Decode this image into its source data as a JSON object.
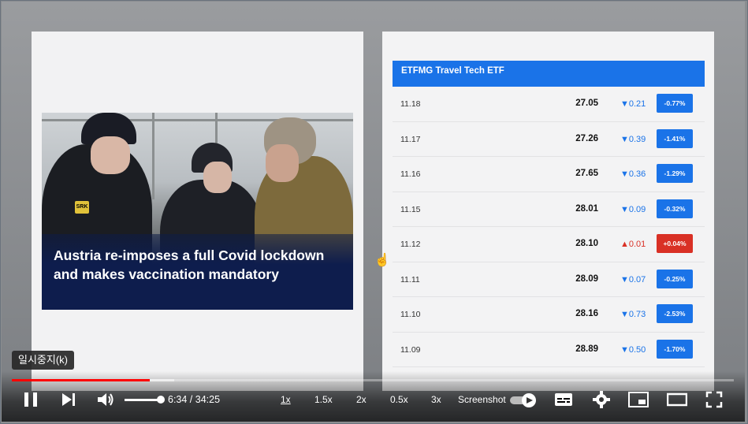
{
  "slide_left": {
    "headline": "Austria re-imposes a full Covid lockdown and makes vaccination mandatory",
    "badge_text": "SRK"
  },
  "table": {
    "title": "ETFMG Travel Tech ETF",
    "rows": [
      {
        "date": "11.18",
        "price": "27.05",
        "change": "▼0.21",
        "pct": "-0.77%",
        "dir": "down"
      },
      {
        "date": "11.17",
        "price": "27.26",
        "change": "▼0.39",
        "pct": "-1.41%",
        "dir": "down"
      },
      {
        "date": "11.16",
        "price": "27.65",
        "change": "▼0.36",
        "pct": "-1.29%",
        "dir": "down"
      },
      {
        "date": "11.15",
        "price": "28.01",
        "change": "▼0.09",
        "pct": "-0.32%",
        "dir": "down"
      },
      {
        "date": "11.12",
        "price": "28.10",
        "change": "▲0.01",
        "pct": "+0.04%",
        "dir": "up"
      },
      {
        "date": "11.11",
        "price": "28.09",
        "change": "▼0.07",
        "pct": "-0.25%",
        "dir": "down"
      },
      {
        "date": "11.10",
        "price": "28.16",
        "change": "▼0.73",
        "pct": "-2.53%",
        "dir": "down"
      },
      {
        "date": "11.09",
        "price": "28.89",
        "change": "▼0.50",
        "pct": "-1.70%",
        "dir": "down"
      }
    ]
  },
  "player": {
    "tooltip": "일시중지(k)",
    "time_display": "6:34 / 34:25",
    "progress_fraction": 0.191,
    "volume_fraction": 1.0,
    "speeds": [
      "1x",
      "1.5x",
      "2x",
      "0.5x",
      "3x"
    ],
    "active_speed": "1x",
    "screenshot_label": "Screenshot"
  },
  "colors": {
    "accent_blue": "#1a73e8",
    "negative_red": "#d93025",
    "progress_red": "#ff0000",
    "headline_navy": "#0e1d4d"
  }
}
